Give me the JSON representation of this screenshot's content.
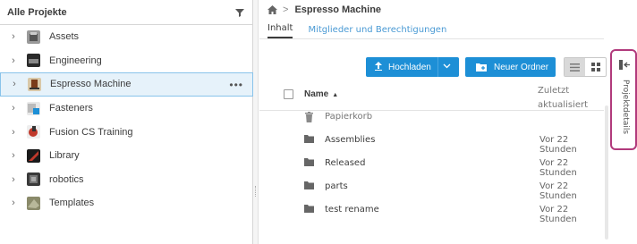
{
  "left_panel": {
    "title": "Alle Projekte",
    "filter_icon": "filter-icon",
    "items": [
      {
        "label": "Assets",
        "thumb": "#8a8a8a",
        "selected": false
      },
      {
        "label": "Engineering",
        "thumb": "#2a2a2a",
        "selected": false
      },
      {
        "label": "Espresso Machine",
        "thumb": "#a0522d",
        "selected": true
      },
      {
        "label": "Fasteners",
        "thumb": "#1d8fd6",
        "selected": false
      },
      {
        "label": "Fusion CS Training",
        "thumb": "#c0392b",
        "selected": false
      },
      {
        "label": "Library",
        "thumb": "#6b2a2a",
        "selected": false
      },
      {
        "label": "robotics",
        "thumb": "#4a4a4a",
        "selected": false
      },
      {
        "label": "Templates",
        "thumb": "#7a7a5a",
        "selected": false
      }
    ],
    "more_label": "•••"
  },
  "breadcrumb": {
    "home_icon": "home-icon",
    "separator": ">",
    "current": "Espresso Machine"
  },
  "tabs": [
    {
      "label": "Inhalt",
      "active": true
    },
    {
      "label": "Mitglieder und Berechtigungen",
      "active": false
    }
  ],
  "toolbar": {
    "upload_label": "Hochladen",
    "new_folder_label": "Neuer Ordner",
    "accent": "#1d8fd6"
  },
  "table": {
    "col_name": "Name",
    "col_updated_line1": "Zuletzt",
    "col_updated_line2": "aktualisiert",
    "rows": [
      {
        "name": "Papierkorb",
        "icon": "trash-icon",
        "updated": ""
      },
      {
        "name": "Assemblies",
        "icon": "folder-icon",
        "updated": "Vor 22 Stunden"
      },
      {
        "name": "Released",
        "icon": "folder-icon",
        "updated": "Vor 22 Stunden"
      },
      {
        "name": "parts",
        "icon": "folder-icon",
        "updated": "Vor 22 Stunden"
      },
      {
        "name": "test rename",
        "icon": "folder-icon",
        "updated": "Vor 22 Stunden"
      }
    ]
  },
  "details_rail": {
    "label": "Projektdetails",
    "highlight": "#b13a7c"
  }
}
